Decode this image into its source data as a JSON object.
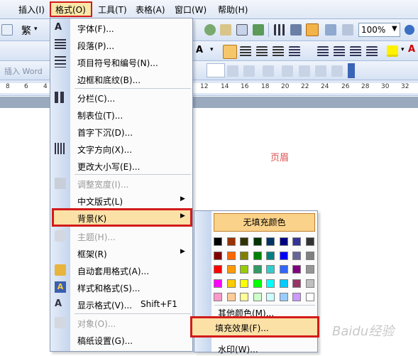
{
  "menubar": {
    "items": [
      "插入(I)",
      "格式(O)",
      "工具(T)",
      "表格(A)",
      "窗口(W)",
      "帮助(H)"
    ]
  },
  "toolbar1": {
    "font_char": "繁",
    "zoom": "100%"
  },
  "toolbar3": {
    "insert_word_placeholder": "插入 Word"
  },
  "ruler": {
    "numbers": [
      "8",
      "6",
      "4",
      "12",
      "14",
      "16",
      "18",
      "20",
      "22",
      "24",
      "26",
      "28",
      "30",
      "32"
    ]
  },
  "document": {
    "header_text": "页眉"
  },
  "format_menu": {
    "items": [
      {
        "label": "字体(F)...",
        "icon": "font-a-icon",
        "disabled": false
      },
      {
        "label": "段落(P)...",
        "icon": "paragraph-icon",
        "disabled": false
      },
      {
        "label": "项目符号和编号(N)...",
        "icon": "bullets-icon",
        "disabled": false
      },
      {
        "label": "边框和底纹(B)...",
        "icon": "",
        "disabled": false
      },
      {
        "label": "分栏(C)...",
        "icon": "columns-icon",
        "disabled": false
      },
      {
        "label": "制表位(T)...",
        "icon": "",
        "disabled": false
      },
      {
        "label": "首字下沉(D)...",
        "icon": "",
        "disabled": false
      },
      {
        "label": "文字方向(X)...",
        "icon": "text-direction-icon",
        "disabled": false
      },
      {
        "label": "更改大小写(E)...",
        "icon": "",
        "disabled": false
      },
      {
        "label": "调整宽度(I)...",
        "icon": "adjust-width-icon",
        "disabled": true
      },
      {
        "label": "中文版式(L)",
        "icon": "",
        "disabled": false
      },
      {
        "label": "背景(K)",
        "icon": "",
        "disabled": false
      },
      {
        "label": "主题(H)...",
        "icon": "theme-icon",
        "disabled": true
      },
      {
        "label": "框架(R)",
        "icon": "",
        "disabled": false
      },
      {
        "label": "自动套用格式(A)...",
        "icon": "autoformat-icon",
        "disabled": false
      },
      {
        "label": "样式和格式(S)...",
        "icon": "styles-icon",
        "disabled": false
      },
      {
        "label": "显示格式(V)...",
        "icon": "reveal-format-icon",
        "disabled": false
      },
      {
        "label": "对象(O)...",
        "icon": "object-icon",
        "disabled": true
      },
      {
        "label": "稿纸设置(G)...",
        "icon": "",
        "disabled": false
      }
    ],
    "reveal_shortcut": "Shift+F1"
  },
  "background_menu": {
    "no_fill": "无填充颜色",
    "more_colors": "其他颜色(M)...",
    "fill_effects": "填充效果(F)...",
    "watermark": "水印(W)...",
    "palette": [
      [
        "#000000",
        "#993300",
        "#333300",
        "#003300",
        "#003366",
        "#000080",
        "#333399",
        "#333333"
      ],
      [
        "#800000",
        "#ff6600",
        "#808000",
        "#008000",
        "#008080",
        "#0000ff",
        "#666699",
        "#808080"
      ],
      [
        "#ff0000",
        "#ff9900",
        "#99cc00",
        "#339966",
        "#33cccc",
        "#3366ff",
        "#800080",
        "#969696"
      ],
      [
        "#ff00ff",
        "#ffcc00",
        "#ffff00",
        "#00ff00",
        "#00ffff",
        "#00ccff",
        "#993366",
        "#c0c0c0"
      ],
      [
        "#ff99cc",
        "#ffcc99",
        "#ffff99",
        "#ccffcc",
        "#ccffff",
        "#99ccff",
        "#cc99ff",
        "#ffffff"
      ]
    ]
  },
  "watermark_text": "Baidu经验"
}
